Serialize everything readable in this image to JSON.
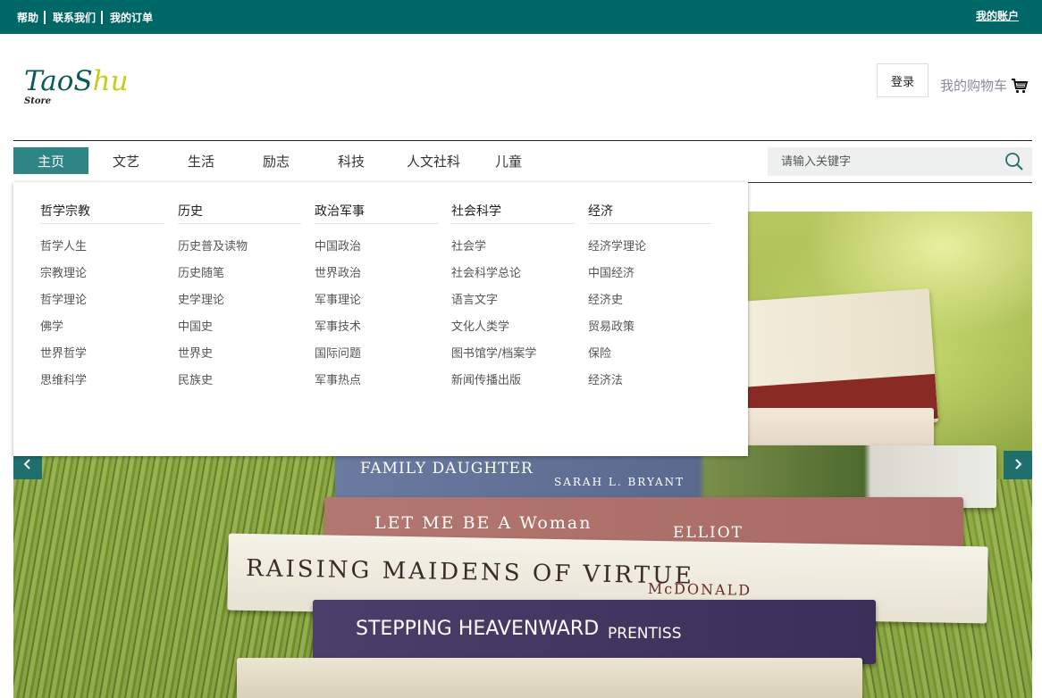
{
  "top_links": [
    "帮助",
    "联系我们",
    "我的订单"
  ],
  "account": "我的账户",
  "logo": {
    "part1": "TaoS",
    "part2": "hu",
    "sub": "Store"
  },
  "login": "登录",
  "cart": "我的购物车",
  "nav": [
    "主页",
    "文艺",
    "生活",
    "励志",
    "科技",
    "人文社科",
    "儿童"
  ],
  "search": {
    "placeholder": "请输入关键字"
  },
  "dropdown": [
    {
      "title": "哲学宗教",
      "items": [
        "哲学人生",
        "宗教理论",
        "哲学理论",
        "佛学",
        "世界哲学",
        "思维科学"
      ]
    },
    {
      "title": "历史",
      "items": [
        "历史普及读物",
        "历史随笔",
        "史学理论",
        "中国史",
        "世界史",
        "民族史"
      ]
    },
    {
      "title": "政治军事",
      "items": [
        "中国政治",
        "世界政治",
        "军事理论",
        "军事技术",
        "国际问题",
        "军事热点"
      ]
    },
    {
      "title": "社会科学",
      "items": [
        "社会学",
        "社会科学总论",
        "语言文字",
        "文化人类学",
        "图书馆学/档案学",
        "新闻传播出版"
      ]
    },
    {
      "title": "经济",
      "items": [
        "经济学理论",
        "中国经济",
        "经济史",
        "贸易政策",
        "保险",
        "经济法"
      ]
    }
  ],
  "banner": {
    "books": [
      {
        "title": "FAMILY DAUGHTER",
        "author": "SARAH L. BRYANT"
      },
      {
        "title": "LET ME BE A Woman",
        "author": "ELLIOT"
      },
      {
        "title": "RAISING MAIDENS OF VIRTUE",
        "author": "McDONALD"
      },
      {
        "title": "STEPPING HEAVENWARD",
        "author": "PRENTISS"
      }
    ]
  }
}
